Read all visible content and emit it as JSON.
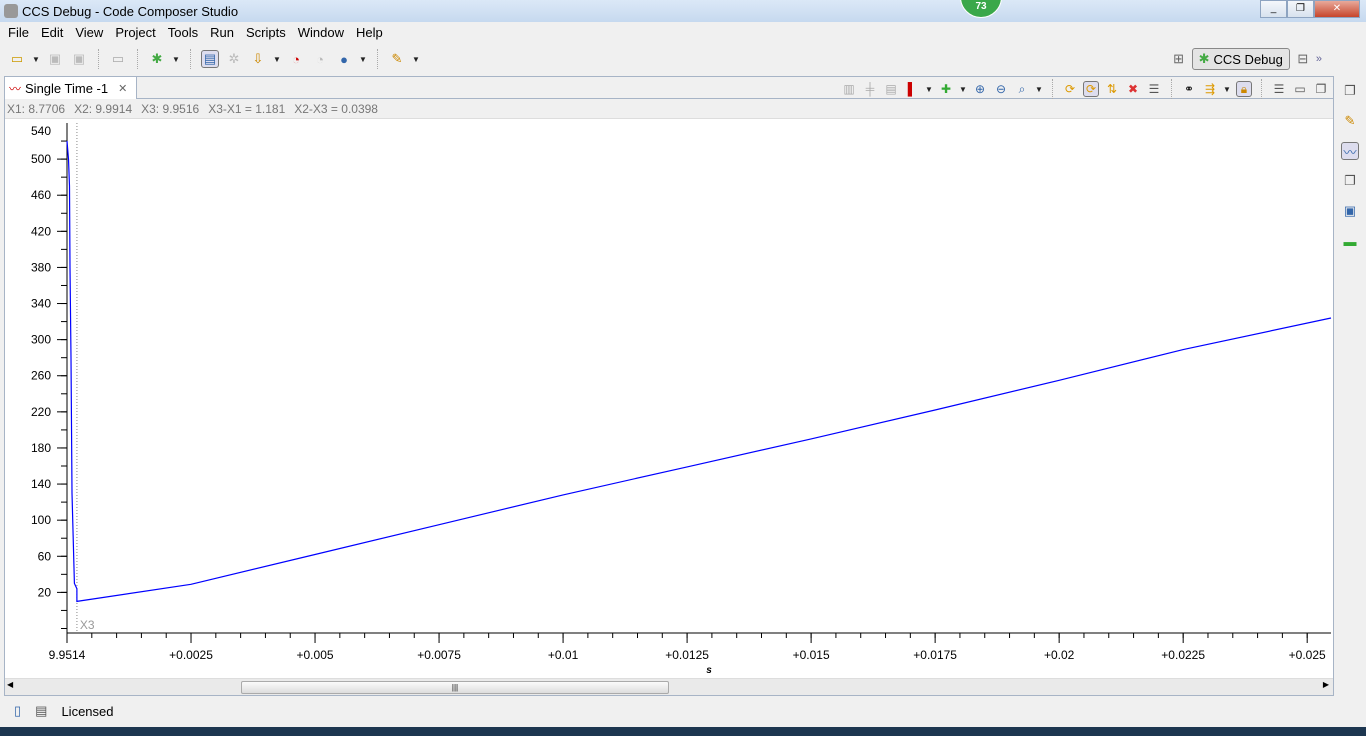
{
  "window": {
    "title": "CCS Debug - Code Composer Studio",
    "notification_count": "73"
  },
  "menu": [
    "File",
    "Edit",
    "View",
    "Project",
    "Tools",
    "Run",
    "Scripts",
    "Window",
    "Help"
  ],
  "perspective": {
    "current": "CCS Debug"
  },
  "view_tab": {
    "label": "Single Time -1"
  },
  "cursor_readout": {
    "x1": "X1: 8.7706",
    "x2": "X2: 9.9914",
    "x3": "X3: 9.9516",
    "x3_x1": "X3-X1 = 1.181",
    "x2_x3": "X2-X3 = 0.0398"
  },
  "status": {
    "license": "Licensed"
  },
  "colors": {
    "series": "#0000ff",
    "accent": "#3aa84a"
  },
  "chart_data": {
    "type": "line",
    "xlabel": "s",
    "x_origin_label": "9.9514",
    "x_tick_labels": [
      "9.9514",
      "+0.0025",
      "+0.005",
      "+0.0075",
      "+0.01",
      "+0.0125",
      "+0.015",
      "+0.0175",
      "+0.02",
      "+0.0225",
      "+0.025"
    ],
    "x_ticks": [
      0,
      0.0025,
      0.005,
      0.0075,
      0.01,
      0.0125,
      0.015,
      0.0175,
      0.02,
      0.0225,
      0.025
    ],
    "y_tick_labels": [
      "540",
      "500",
      "460",
      "420",
      "380",
      "340",
      "300",
      "260",
      "220",
      "180",
      "140",
      "100",
      "60",
      "20"
    ],
    "y_ticks": [
      500,
      460,
      420,
      380,
      340,
      300,
      260,
      220,
      180,
      140,
      100,
      60,
      20
    ],
    "xlim": [
      0,
      0.02548
    ],
    "ylim": [
      -25,
      540
    ],
    "cursor_marker": {
      "label": "X3",
      "x": 0.0002
    },
    "series": [
      {
        "name": "Single Time",
        "x": [
          0,
          3e-05,
          5e-05,
          6e-05,
          8e-05,
          0.0001,
          0.00015,
          0.0002,
          0.0002,
          0.0025,
          0.005,
          0.0075,
          0.01,
          0.0125,
          0.015,
          0.0175,
          0.02,
          0.0225,
          0.02548
        ],
        "y": [
          520,
          500,
          470,
          380,
          280,
          130,
          30,
          24,
          10,
          29,
          62,
          95,
          128,
          159,
          190,
          222,
          255,
          289,
          324
        ]
      }
    ]
  }
}
